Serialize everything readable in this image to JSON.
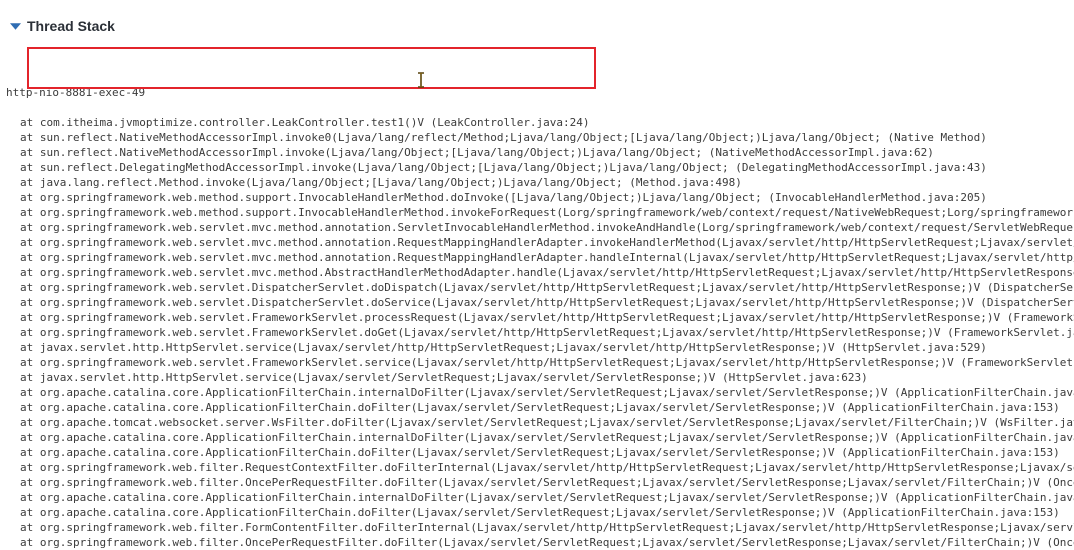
{
  "section": {
    "title": "Thread Stack",
    "toggle_icon": "caret-down-icon",
    "accent_color": "#2f6db3"
  },
  "thread_name": "http-nio-8881-exec-49",
  "frames": [
    "at com.itheima.jvmoptimize.controller.LeakController.test1()V (LeakController.java:24)",
    "at sun.reflect.NativeMethodAccessorImpl.invoke0(Ljava/lang/reflect/Method;Ljava/lang/Object;[Ljava/lang/Object;)Ljava/lang/Object; (Native Method)",
    "at sun.reflect.NativeMethodAccessorImpl.invoke(Ljava/lang/Object;[Ljava/lang/Object;)Ljava/lang/Object; (NativeMethodAccessorImpl.java:62)",
    "at sun.reflect.DelegatingMethodAccessorImpl.invoke(Ljava/lang/Object;[Ljava/lang/Object;)Ljava/lang/Object; (DelegatingMethodAccessorImpl.java:43)",
    "at java.lang.reflect.Method.invoke(Ljava/lang/Object;[Ljava/lang/Object;)Ljava/lang/Object; (Method.java:498)",
    "at org.springframework.web.method.support.InvocableHandlerMethod.doInvoke([Ljava/lang/Object;)Ljava/lang/Object; (InvocableHandlerMethod.java:205)",
    "at org.springframework.web.method.support.InvocableHandlerMethod.invokeForRequest(Lorg/springframework/web/context/request/NativeWebRequest;Lorg/springframework.",
    "at org.springframework.web.servlet.mvc.method.annotation.ServletInvocableHandlerMethod.invokeAndHandle(Lorg/springframework/web/context/request/ServletWebRequest",
    "at org.springframework.web.servlet.mvc.method.annotation.RequestMappingHandlerAdapter.invokeHandlerMethod(Ljavax/servlet/http/HttpServletRequest;Ljavax/servlet/",
    "at org.springframework.web.servlet.mvc.method.annotation.RequestMappingHandlerAdapter.handleInternal(Ljavax/servlet/http/HttpServletRequest;Ljavax/servlet/http/H",
    "at org.springframework.web.servlet.mvc.method.AbstractHandlerMethodAdapter.handle(Ljavax/servlet/http/HttpServletRequest;Ljavax/servlet/http/HttpServletResponse",
    "at org.springframework.web.servlet.DispatcherServlet.doDispatch(Ljavax/servlet/http/HttpServletRequest;Ljavax/servlet/http/HttpServletResponse;)V (DispatcherServ",
    "at org.springframework.web.servlet.DispatcherServlet.doService(Ljavax/servlet/http/HttpServletRequest;Ljavax/servlet/http/HttpServletResponse;)V (DispatcherServle",
    "at org.springframework.web.servlet.FrameworkServlet.processRequest(Ljavax/servlet/http/HttpServletRequest;Ljavax/servlet/http/HttpServletResponse;)V (FrameworkSe",
    "at org.springframework.web.servlet.FrameworkServlet.doGet(Ljavax/servlet/http/HttpServletRequest;Ljavax/servlet/http/HttpServletResponse;)V (FrameworkServlet.ja",
    "at javax.servlet.http.HttpServlet.service(Ljavax/servlet/http/HttpServletRequest;Ljavax/servlet/http/HttpServletResponse;)V (HttpServlet.java:529)",
    "at org.springframework.web.servlet.FrameworkServlet.service(Ljavax/servlet/http/HttpServletRequest;Ljavax/servlet/http/HttpServletResponse;)V (FrameworkServlet.",
    "at javax.servlet.http.HttpServlet.service(Ljavax/servlet/ServletRequest;Ljavax/servlet/ServletResponse;)V (HttpServlet.java:623)",
    "at org.apache.catalina.core.ApplicationFilterChain.internalDoFilter(Ljavax/servlet/ServletRequest;Ljavax/servlet/ServletResponse;)V (ApplicationFilterChain.java",
    "at org.apache.catalina.core.ApplicationFilterChain.doFilter(Ljavax/servlet/ServletRequest;Ljavax/servlet/ServletResponse;)V (ApplicationFilterChain.java:153)",
    "at org.apache.tomcat.websocket.server.WsFilter.doFilter(Ljavax/servlet/ServletRequest;Ljavax/servlet/ServletResponse;Ljavax/servlet/FilterChain;)V (WsFilter.java",
    "at org.apache.catalina.core.ApplicationFilterChain.internalDoFilter(Ljavax/servlet/ServletRequest;Ljavax/servlet/ServletResponse;)V (ApplicationFilterChain.java",
    "at org.apache.catalina.core.ApplicationFilterChain.doFilter(Ljavax/servlet/ServletRequest;Ljavax/servlet/ServletResponse;)V (ApplicationFilterChain.java:153)",
    "at org.springframework.web.filter.RequestContextFilter.doFilterInternal(Ljavax/servlet/http/HttpServletRequest;Ljavax/servlet/http/HttpServletResponse;Ljavax/se",
    "at org.springframework.web.filter.OncePerRequestFilter.doFilter(Ljavax/servlet/ServletRequest;Ljavax/servlet/ServletResponse;Ljavax/servlet/FilterChain;)V (Once",
    "at org.apache.catalina.core.ApplicationFilterChain.internalDoFilter(Ljavax/servlet/ServletRequest;Ljavax/servlet/ServletResponse;)V (ApplicationFilterChain.java",
    "at org.apache.catalina.core.ApplicationFilterChain.doFilter(Ljavax/servlet/ServletRequest;Ljavax/servlet/ServletResponse;)V (ApplicationFilterChain.java:153)",
    "at org.springframework.web.filter.FormContentFilter.doFilterInternal(Ljavax/servlet/http/HttpServletRequest;Ljavax/servlet/http/HttpServletResponse;Ljavax/servle",
    "at org.springframework.web.filter.OncePerRequestFilter.doFilter(Ljavax/servlet/ServletRequest;Ljavax/servlet/ServletResponse;Ljavax/servlet/FilterChain;)V (Once"
  ],
  "highlight": {
    "color": "#e3242b",
    "cursor_icon": "text-cursor-icon"
  }
}
